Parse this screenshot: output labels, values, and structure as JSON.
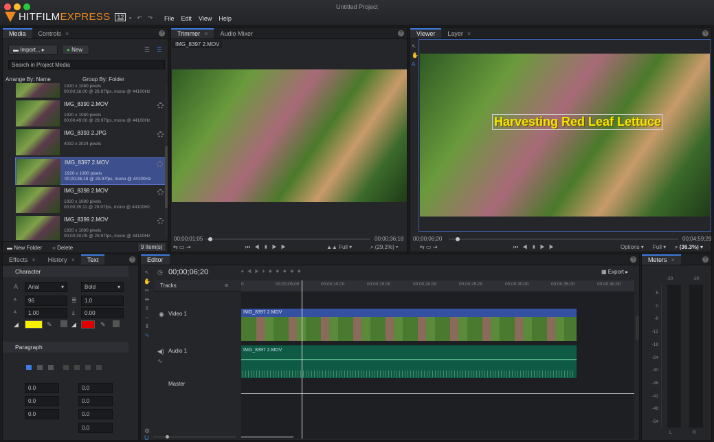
{
  "window": {
    "title": "Untitled Project"
  },
  "brand": {
    "name_a": "HITFILM",
    "name_b": "EXPRESS",
    "version": "12"
  },
  "menu": [
    "File",
    "Edit",
    "View",
    "Help"
  ],
  "media_panel": {
    "tabs": [
      {
        "label": "Media",
        "close": ""
      },
      {
        "label": "Controls",
        "close": "×"
      }
    ],
    "import_label": "Import...",
    "new_label": "New",
    "search_placeholder": "Search in Project Media",
    "arrange_label": "Arrange By: Name",
    "group_label": "Group By: Folder",
    "items": [
      {
        "name": "",
        "meta1": "1920 x 1080 pixels",
        "meta2": "00;00;16;00 @ 29.97fps, mono @ 44100Hz"
      },
      {
        "name": "IMG_8390 2.MOV",
        "meta1": "1920 x 1080 pixels",
        "meta2": "00;00;49;00 @ 29.97fps, mono @ 44100Hz"
      },
      {
        "name": "IMG_8393 2.JPG",
        "meta1": "4032 x 3024 pixels",
        "meta2": ""
      },
      {
        "name": "IMG_8397 2.MOV",
        "meta1": "1920 x 1080 pixels",
        "meta2": "00;00;36;18 @ 29.97fps, mono @ 44100Hz"
      },
      {
        "name": "IMG_8398 2.MOV",
        "meta1": "1920 x 1080 pixels",
        "meta2": "00;00;35;11 @ 29.97fps, mono @ 44100Hz"
      },
      {
        "name": "IMG_8399 2.MOV",
        "meta1": "1920 x 1080 pixels",
        "meta2": "00;00;30;05 @ 29.97fps, mono @ 44100Hz"
      }
    ],
    "new_folder_label": "New Folder",
    "delete_label": "Delete",
    "count_label": "9 Item(s)"
  },
  "trimmer": {
    "tabs": [
      {
        "label": "Trimmer",
        "close": "×"
      },
      {
        "label": "Audio Mixer",
        "close": ""
      }
    ],
    "clip_name": "IMG_8397 2.MOV",
    "time_start": "00;00;01;05",
    "time_end": "00;00;36;18",
    "quality": "Full",
    "zoom": "(29.2%)"
  },
  "viewer": {
    "tabs": [
      {
        "label": "Viewer",
        "close": ""
      },
      {
        "label": "Layer",
        "close": "×"
      }
    ],
    "overlay_text": "Harvesting Red Leaf Lettuce",
    "time_current": "00;00;06;20",
    "time_end": "00;04;59;29",
    "options_label": "Options",
    "quality": "Full",
    "zoom": "(36.3%)"
  },
  "text_panel": {
    "tabs": [
      {
        "label": "Effects",
        "close": "×"
      },
      {
        "label": "History",
        "close": "×"
      },
      {
        "label": "Text",
        "close": ""
      }
    ],
    "character_label": "Character",
    "font": "Arial",
    "weight": "Bold",
    "size": "96",
    "leading": "1.0",
    "scale": "1.00",
    "tracking": "0.00",
    "fill_color": "#f7f000",
    "stroke_color": "#e00000",
    "paragraph_label": "Paragraph",
    "spacing": [
      "0.0",
      "0.0",
      "0.0",
      "0.0",
      "0.0",
      "0.0",
      "0.0"
    ]
  },
  "editor": {
    "tab": "Editor",
    "timecode": "00;00;06;20",
    "export_label": "Export",
    "tracks_label": "Tracks",
    "video_track": "Video 1",
    "audio_track": "Audio 1",
    "master_track": "Master",
    "clip_name_video": "IMG_8397 2.MOV",
    "clip_name_audio": "IMG_8397 2.MOV",
    "ruler": [
      "0",
      "00;00;05;00",
      "00;00;10;00",
      "00;00;15;00",
      "00;00;20;00",
      "00;00;25;00",
      "00;00;30;00",
      "00;00;35;00",
      "00;00;40;00"
    ]
  },
  "meters": {
    "tab": "Meters",
    "close": "×",
    "top_left": "-20",
    "top_right": "-20",
    "scale": [
      "6",
      "0",
      "-6",
      "-12",
      "-18",
      "-24",
      "-30",
      "-36",
      "-42",
      "-48",
      "-54"
    ],
    "channels": [
      "L",
      "R"
    ]
  },
  "colors": {
    "accent": "#3b7de0",
    "brand": "#f08a1e",
    "selection": "#3d4f8c",
    "audio_clip": "#0e5a44"
  },
  "icons": [
    "folder-icon",
    "undo-icon",
    "redo-icon",
    "gear-icon",
    "play-icon",
    "search-icon",
    "speaker-icon",
    "eye-icon",
    "magnet-icon"
  ]
}
